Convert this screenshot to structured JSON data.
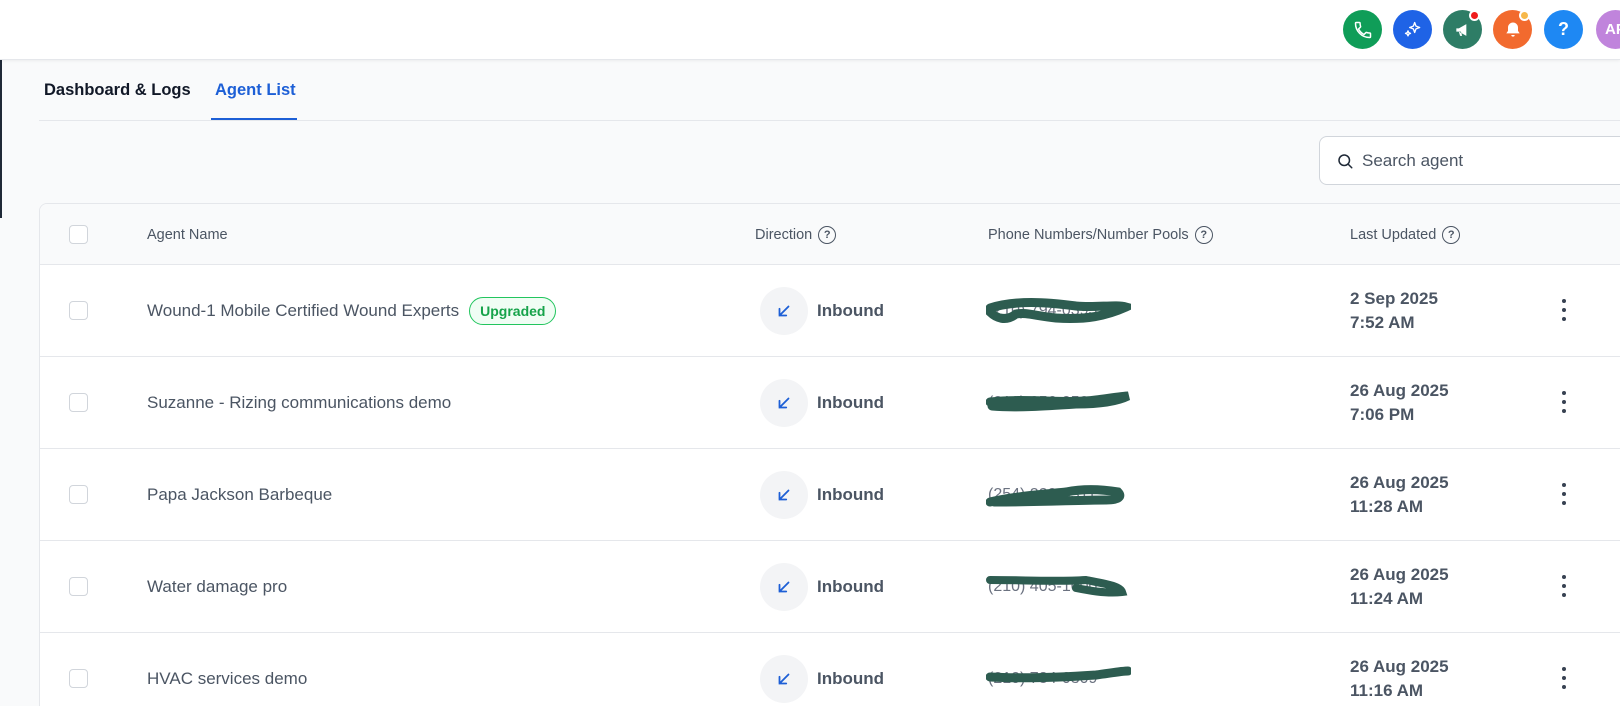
{
  "header": {
    "icons": [
      {
        "name": "phone-icon",
        "color": "#0f9d58"
      },
      {
        "name": "sparkle-icon",
        "color": "#1f63e6"
      },
      {
        "name": "megaphone-icon",
        "color": "#2e7d66",
        "badge_color": "#ef1c1c"
      },
      {
        "name": "bell-icon",
        "color": "#f26a2e",
        "badge_color": "#f7b84b"
      },
      {
        "name": "help-icon",
        "color": "#1e88f3",
        "label": "?"
      }
    ],
    "avatar_initials": "AP"
  },
  "tabs": [
    {
      "label": "Dashboard & Logs",
      "active": false
    },
    {
      "label": "Agent List",
      "active": true
    }
  ],
  "search": {
    "placeholder": "Search agent",
    "value": ""
  },
  "table": {
    "columns": [
      "Agent Name",
      "Direction",
      "Phone Numbers/Number Pools",
      "Last Updated"
    ],
    "rows": [
      {
        "name": "Wound-1 Mobile Certified Wound Experts",
        "badge": "Upgraded",
        "direction": "Inbound",
        "phone": "(210) 794-0393",
        "date": "2 Sep 2025",
        "time": "7:52 AM"
      },
      {
        "name": "Suzanne - Rizing communications demo",
        "badge": "",
        "direction": "Inbound",
        "phone": "(210) 256-0523",
        "date": "26 Aug 2025",
        "time": "7:06 PM"
      },
      {
        "name": "Papa Jackson Barbeque",
        "badge": "",
        "direction": "Inbound",
        "phone": "(254) 220-0311",
        "date": "26 Aug 2025",
        "time": "11:28 AM"
      },
      {
        "name": "Water damage pro",
        "badge": "",
        "direction": "Inbound",
        "phone": "(210) 405-1000",
        "date": "26 Aug 2025",
        "time": "11:24 AM"
      },
      {
        "name": "HVAC services demo",
        "badge": "",
        "direction": "Inbound",
        "phone": "(210) 784-0309",
        "date": "26 Aug 2025",
        "time": "11:16 AM"
      }
    ]
  },
  "colors": {
    "accent": "#1d5fd6",
    "redaction": "#2d5c50",
    "badge_green": "#16a34a"
  }
}
